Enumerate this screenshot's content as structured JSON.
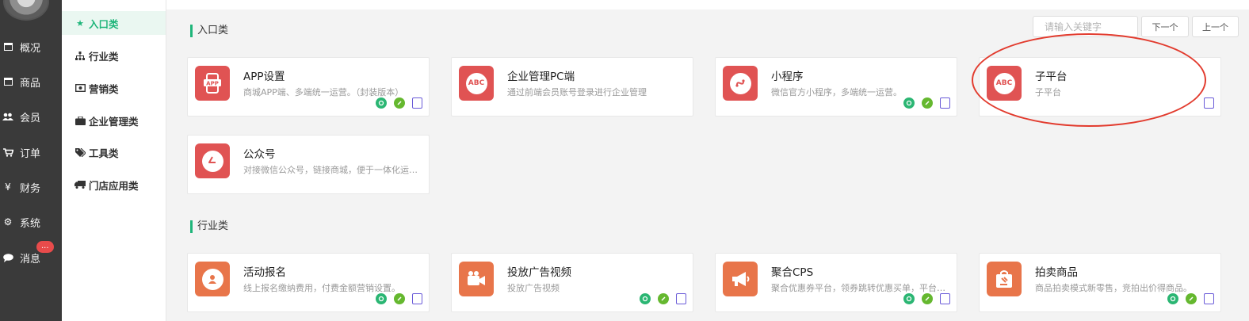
{
  "left_nav": {
    "items": [
      {
        "label": "概况",
        "icon": "archive-icon"
      },
      {
        "label": "商品",
        "icon": "archive-icon"
      },
      {
        "label": "会员",
        "icon": "users-icon"
      },
      {
        "label": "订单",
        "icon": "cart-icon"
      },
      {
        "label": "财务",
        "icon": "yen-icon"
      },
      {
        "label": "系统",
        "icon": "gears-icon"
      },
      {
        "label": "消息",
        "icon": "chat-icon"
      }
    ],
    "message_badge": "..."
  },
  "sub_nav": {
    "items": [
      {
        "label": "入口类",
        "icon": "star-icon",
        "active": true
      },
      {
        "label": "行业类",
        "icon": "sitemap-icon"
      },
      {
        "label": "营销类",
        "icon": "money-icon"
      },
      {
        "label": "企业管理类",
        "icon": "briefcase-icon"
      },
      {
        "label": "工具类",
        "icon": "tags-icon"
      },
      {
        "label": "门店应用类",
        "icon": "truck-icon"
      }
    ]
  },
  "search": {
    "placeholder": "请输入关键字",
    "next_label": "下一个",
    "prev_label": "上一个"
  },
  "sections": [
    {
      "title": "入口类",
      "cards": [
        {
          "name": "APP设置",
          "desc": "商城APP端、多端统一运营。（封装版本）",
          "logo_text": "APP",
          "color": "#e05353"
        },
        {
          "name": "企业管理PC端",
          "desc": "通过前端会员账号登录进行企业管理",
          "logo_text": "ABC",
          "color": "#e05353"
        },
        {
          "name": "小程序",
          "desc": "微信官方小程序，多端统一运营。",
          "logo_text": "mini-program-icon",
          "color": "#e05353"
        },
        {
          "name": "子平台",
          "desc": "子平台",
          "logo_text": "ABC",
          "color": "#e05353"
        },
        {
          "name": "公众号",
          "desc": "对接微信公众号，链接商城，便于一体化运营。",
          "logo_text": "wechat-icon",
          "color": "#e05353"
        }
      ]
    },
    {
      "title": "行业类",
      "cards": [
        {
          "name": "活动报名",
          "desc": "线上报名缴纳费用，付费金额营销设置。",
          "color": "#e8754a"
        },
        {
          "name": "投放广告视频",
          "desc": "投放广告视频",
          "color": "#e8754a"
        },
        {
          "name": "聚合CPS",
          "desc": "聚合优惠券平台，领券跳转优惠买单，平台返利。",
          "color": "#e8754a"
        },
        {
          "name": "拍卖商品",
          "desc": "商品拍卖模式新零售，竞拍出价得商品。",
          "color": "#e8754a"
        }
      ]
    }
  ],
  "colors": {
    "accent": "#1fb57a",
    "annotation": "#e23b2e",
    "nav_bg": "#3a3a3a"
  }
}
